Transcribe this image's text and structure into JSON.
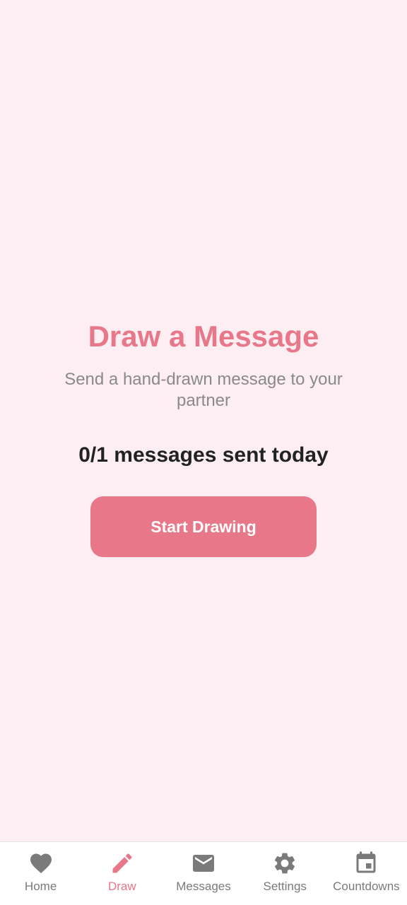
{
  "main": {
    "title": "Draw a Message",
    "subtitle": "Send a hand-drawn message to your partner",
    "counter_text": "0/1 messages sent today",
    "start_button_label": "Start Drawing"
  },
  "bottom_nav": {
    "items": [
      {
        "label": "Home",
        "icon": "heart-icon",
        "active": false
      },
      {
        "label": "Draw",
        "icon": "pencil-icon",
        "active": true
      },
      {
        "label": "Messages",
        "icon": "mail-icon",
        "active": false
      },
      {
        "label": "Settings",
        "icon": "gear-icon",
        "active": false
      },
      {
        "label": "Countdowns",
        "icon": "calendar-icon",
        "active": false
      }
    ]
  },
  "colors": {
    "background": "#fdeef3",
    "accent": "#e87889",
    "inactive": "#7a7a7a",
    "text_dark": "#222222"
  }
}
